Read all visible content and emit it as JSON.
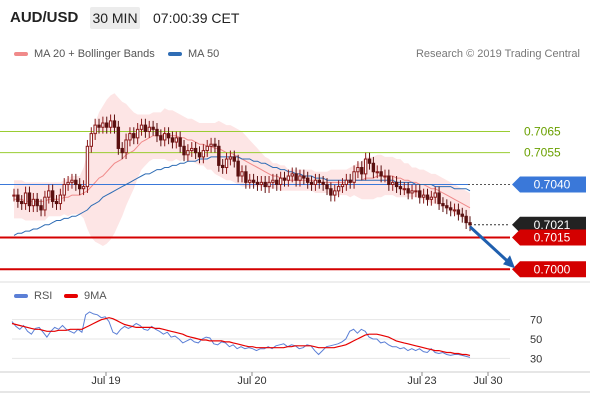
{
  "header": {
    "pair": "AUD/USD",
    "timeframe": "30 MIN",
    "time": "07:00:39 CET"
  },
  "legend": {
    "bollinger_label": "MA 20 + Bollinger Bands",
    "ma50_label": "MA 50",
    "research": "Research © 2019 Trading Central",
    "rsi_label": "RSI",
    "ma9_label": "9MA"
  },
  "colors": {
    "bollinger": "#f08a8a",
    "ma50": "#2f6db5",
    "rsi": "#5b7fd6",
    "ma9": "#e60000",
    "candle_up": "#8b1a1a",
    "candle_down": "#5a1010",
    "band_fill": "#fde0e0",
    "support": "#d40000",
    "pivot": "#3a78d9",
    "resistance": "#9acd32"
  },
  "chart_data": [
    {
      "type": "candlestick",
      "ylim": [
        0.6994,
        0.7094
      ],
      "x_tick_labels": [
        "Jul 19",
        "Jul 20",
        "Jul 23",
        "Jul 30"
      ],
      "levels": [
        {
          "value": 0.7065,
          "label": "0.7065",
          "kind": "resistance"
        },
        {
          "value": 0.7055,
          "label": "0.7055",
          "kind": "resistance"
        },
        {
          "value": 0.704,
          "label": "0.7040",
          "kind": "pivot"
        },
        {
          "value": 0.7021,
          "label": "0.7021",
          "kind": "last"
        },
        {
          "value": 0.7015,
          "label": "0.7015",
          "kind": "support"
        },
        {
          "value": 0.7,
          "label": "0.7000",
          "kind": "support"
        }
      ],
      "close": [
        0.7035,
        0.7032,
        0.7031,
        0.7036,
        0.703,
        0.7033,
        0.703,
        0.7028,
        0.7034,
        0.7037,
        0.7032,
        0.7031,
        0.7035,
        0.704,
        0.7041,
        0.7042,
        0.704,
        0.7038,
        0.7039,
        0.7058,
        0.7064,
        0.7068,
        0.7067,
        0.7069,
        0.7067,
        0.707,
        0.7067,
        0.7057,
        0.7055,
        0.7061,
        0.7064,
        0.7062,
        0.7066,
        0.7068,
        0.7065,
        0.7067,
        0.7066,
        0.7063,
        0.7061,
        0.7064,
        0.7062,
        0.706,
        0.7062,
        0.7058,
        0.7054,
        0.7056,
        0.7057,
        0.7055,
        0.7053,
        0.7056,
        0.7058,
        0.7059,
        0.7058,
        0.7049,
        0.7048,
        0.7052,
        0.7053,
        0.7051,
        0.7044,
        0.7046,
        0.7041,
        0.7042,
        0.7041,
        0.704,
        0.7041,
        0.7039,
        0.7041,
        0.7042,
        0.704,
        0.7043,
        0.7042,
        0.7044,
        0.7045,
        0.7042,
        0.7044,
        0.7043,
        0.7041,
        0.704,
        0.7042,
        0.7041,
        0.704,
        0.7038,
        0.7035,
        0.7037,
        0.7039,
        0.704,
        0.7042,
        0.7041,
        0.7046,
        0.7048,
        0.7045,
        0.7052,
        0.705,
        0.7046,
        0.7046,
        0.7044,
        0.7044,
        0.704,
        0.7041,
        0.7039,
        0.7038,
        0.7038,
        0.7036,
        0.7037,
        0.7037,
        0.7034,
        0.7035,
        0.7033,
        0.7034,
        0.7036,
        0.7031,
        0.703,
        0.7029,
        0.7028,
        0.7028,
        0.7026,
        0.7025,
        0.7022,
        0.7021
      ],
      "bollinger_mid": [
        0.7033,
        0.7033,
        0.7033,
        0.7032,
        0.7032,
        0.7032,
        0.7032,
        0.7032,
        0.7032,
        0.7033,
        0.7033,
        0.7033,
        0.7033,
        0.7034,
        0.7034,
        0.7035,
        0.7035,
        0.7035,
        0.7036,
        0.7037,
        0.7039,
        0.7041,
        0.7043,
        0.7044,
        0.7046,
        0.7048,
        0.705,
        0.7051,
        0.7052,
        0.7054,
        0.7055,
        0.7056,
        0.7058,
        0.706,
        0.7061,
        0.7062,
        0.7063,
        0.7063,
        0.7063,
        0.7064,
        0.7063,
        0.7063,
        0.7063,
        0.7062,
        0.7062,
        0.7061,
        0.7061,
        0.706,
        0.7059,
        0.7059,
        0.7058,
        0.7058,
        0.7057,
        0.7057,
        0.7056,
        0.7055,
        0.7055,
        0.7054,
        0.7053,
        0.7052,
        0.7051,
        0.705,
        0.7049,
        0.7048,
        0.7047,
        0.7046,
        0.7045,
        0.7044,
        0.7044,
        0.7043,
        0.7043,
        0.7042,
        0.7042,
        0.7042,
        0.7042,
        0.7042,
        0.7042,
        0.7042,
        0.7041,
        0.7041,
        0.7041,
        0.7041,
        0.7041,
        0.7041,
        0.7041,
        0.7041,
        0.7041,
        0.7041,
        0.7042,
        0.7042,
        0.7042,
        0.7043,
        0.7043,
        0.7043,
        0.7044,
        0.7044,
        0.7044,
        0.7044,
        0.7044,
        0.7043,
        0.7043,
        0.7042,
        0.7042,
        0.7041,
        0.7041,
        0.704,
        0.704,
        0.7039,
        0.7038,
        0.7038,
        0.7037,
        0.7036,
        0.7035,
        0.7034,
        0.7033,
        0.7032,
        0.7031,
        0.703,
        0.7029
      ],
      "bollinger_band_width": [
        0.0009,
        0.0009,
        0.0009,
        0.0009,
        0.0009,
        0.0009,
        0.0009,
        0.0009,
        0.0009,
        0.0008,
        0.0008,
        0.0008,
        0.0008,
        0.0008,
        0.0009,
        0.0009,
        0.0009,
        0.0009,
        0.0012,
        0.0018,
        0.0024,
        0.0028,
        0.0031,
        0.0033,
        0.0034,
        0.0034,
        0.0033,
        0.003,
        0.0027,
        0.0024,
        0.0021,
        0.0018,
        0.0015,
        0.0013,
        0.0012,
        0.0011,
        0.0011,
        0.0011,
        0.0011,
        0.0012,
        0.0012,
        0.0012,
        0.0011,
        0.0011,
        0.001,
        0.001,
        0.001,
        0.001,
        0.001,
        0.001,
        0.0011,
        0.0011,
        0.0012,
        0.0013,
        0.0013,
        0.0013,
        0.0013,
        0.0013,
        0.0013,
        0.0013,
        0.0012,
        0.0011,
        0.001,
        0.0009,
        0.0008,
        0.0007,
        0.0007,
        0.0006,
        0.0006,
        0.0006,
        0.0006,
        0.0005,
        0.0005,
        0.0005,
        0.0005,
        0.0005,
        0.0005,
        0.0005,
        0.0005,
        0.0005,
        0.0005,
        0.0005,
        0.0006,
        0.0006,
        0.0006,
        0.0006,
        0.0006,
        0.0007,
        0.0007,
        0.0008,
        0.0009,
        0.001,
        0.001,
        0.001,
        0.001,
        0.001,
        0.0009,
        0.0009,
        0.0009,
        0.0009,
        0.0009,
        0.0008,
        0.0008,
        0.0007,
        0.0007,
        0.0007,
        0.0007,
        0.0007,
        0.0007,
        0.0007,
        0.0007,
        0.0007,
        0.0007,
        0.0007,
        0.0007,
        0.0007,
        0.0007,
        0.0007,
        0.0007
      ],
      "ma50": [
        0.7016,
        0.7017,
        0.7017,
        0.7018,
        0.7018,
        0.7019,
        0.7019,
        0.702,
        0.7021,
        0.7021,
        0.7022,
        0.7023,
        0.7023,
        0.7024,
        0.7024,
        0.7025,
        0.7025,
        0.7026,
        0.7027,
        0.7028,
        0.703,
        0.7031,
        0.7032,
        0.7034,
        0.7035,
        0.7036,
        0.7037,
        0.7038,
        0.7039,
        0.704,
        0.7041,
        0.7042,
        0.7043,
        0.7044,
        0.7045,
        0.7045,
        0.7046,
        0.7047,
        0.7047,
        0.7048,
        0.7048,
        0.7049,
        0.7049,
        0.705,
        0.705,
        0.7051,
        0.7051,
        0.7051,
        0.7052,
        0.7052,
        0.7052,
        0.7053,
        0.7053,
        0.7053,
        0.7053,
        0.7053,
        0.7053,
        0.7053,
        0.7053,
        0.7052,
        0.7052,
        0.7052,
        0.7051,
        0.7051,
        0.705,
        0.705,
        0.7049,
        0.7048,
        0.7048,
        0.7047,
        0.7047,
        0.7046,
        0.7046,
        0.7045,
        0.7045,
        0.7044,
        0.7044,
        0.7044,
        0.7043,
        0.7043,
        0.7043,
        0.7042,
        0.7042,
        0.7042,
        0.7042,
        0.7042,
        0.7042,
        0.7042,
        0.7042,
        0.7042,
        0.7042,
        0.7042,
        0.7042,
        0.7042,
        0.7042,
        0.7042,
        0.7042,
        0.7042,
        0.7042,
        0.7041,
        0.7041,
        0.7041,
        0.7041,
        0.7041,
        0.704,
        0.704,
        0.704,
        0.704,
        0.704,
        0.7039,
        0.7039,
        0.7039,
        0.7039,
        0.7039,
        0.7038,
        0.7038,
        0.7038,
        0.7038,
        0.7037
      ]
    },
    {
      "type": "line",
      "ylim": [
        20,
        80
      ],
      "y_tick_labels": [
        "70",
        "50",
        "30"
      ],
      "y_ticks": [
        70,
        50,
        30
      ],
      "series": [
        {
          "name": "RSI",
          "values": [
            68,
            63,
            60,
            64,
            58,
            55,
            61,
            62,
            57,
            52,
            58,
            62,
            60,
            64,
            60,
            58,
            56,
            60,
            57,
            75,
            78,
            76,
            75,
            72,
            73,
            68,
            57,
            55,
            60,
            63,
            61,
            63,
            66,
            64,
            60,
            59,
            63,
            60,
            58,
            55,
            57,
            52,
            53,
            50,
            46,
            48,
            50,
            47,
            46,
            50,
            52,
            51,
            45,
            44,
            47,
            46,
            42,
            44,
            40,
            42,
            40,
            41,
            40,
            38,
            40,
            40,
            42,
            40,
            43,
            44,
            45,
            42,
            44,
            43,
            40,
            41,
            44,
            43,
            38,
            34,
            38,
            42,
            43,
            44,
            45,
            47,
            50,
            58,
            60,
            56,
            60,
            58,
            52,
            50,
            50,
            46,
            47,
            44,
            42,
            42,
            40,
            41,
            38,
            40,
            38,
            40,
            37,
            36,
            40,
            36,
            35,
            36,
            34,
            33,
            34,
            34,
            33,
            32,
            31
          ]
        },
        {
          "name": "9MA",
          "values": [
            66,
            65,
            64,
            63,
            62,
            61,
            60,
            60,
            59,
            58,
            58,
            58,
            59,
            59,
            59,
            60,
            60,
            60,
            60,
            62,
            64,
            66,
            68,
            70,
            71,
            72,
            71,
            69,
            67,
            65,
            64,
            63,
            62,
            62,
            62,
            62,
            62,
            61,
            61,
            60,
            59,
            58,
            57,
            56,
            55,
            53,
            52,
            51,
            50,
            49,
            49,
            48,
            48,
            48,
            48,
            47,
            47,
            46,
            45,
            44,
            43,
            42,
            42,
            41,
            41,
            41,
            41,
            41,
            41,
            41,
            41,
            42,
            42,
            43,
            43,
            43,
            43,
            43,
            42,
            41,
            41,
            41,
            41,
            41,
            42,
            43,
            44,
            46,
            48,
            50,
            52,
            54,
            55,
            55,
            55,
            54,
            53,
            52,
            50,
            48,
            47,
            46,
            45,
            44,
            43,
            42,
            41,
            40,
            39,
            38,
            38,
            37,
            36,
            36,
            35,
            35,
            34,
            34,
            33
          ]
        }
      ]
    }
  ]
}
